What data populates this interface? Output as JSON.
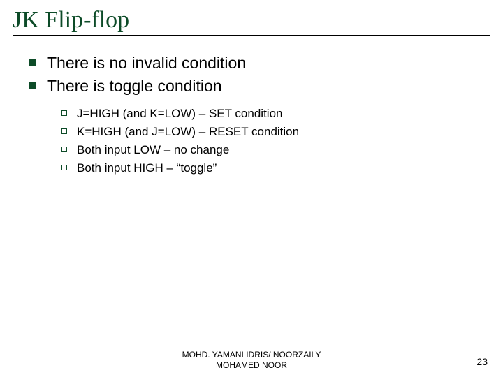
{
  "title": "JK Flip-flop",
  "main_items": [
    {
      "text": "There is no invalid condition"
    },
    {
      "text": "There is toggle condition"
    }
  ],
  "sub_items": [
    {
      "text": "J=HIGH (and K=LOW) – SET condition"
    },
    {
      "text": "K=HIGH (and J=LOW) – RESET condition"
    },
    {
      "text": "Both input LOW – no change"
    },
    {
      "text": "Both input HIGH – “toggle”"
    }
  ],
  "footer": {
    "line1": "MOHD. YAMANI IDRIS/ NOORZAILY",
    "line2": "MOHAMED NOOR"
  },
  "page_number": "23"
}
